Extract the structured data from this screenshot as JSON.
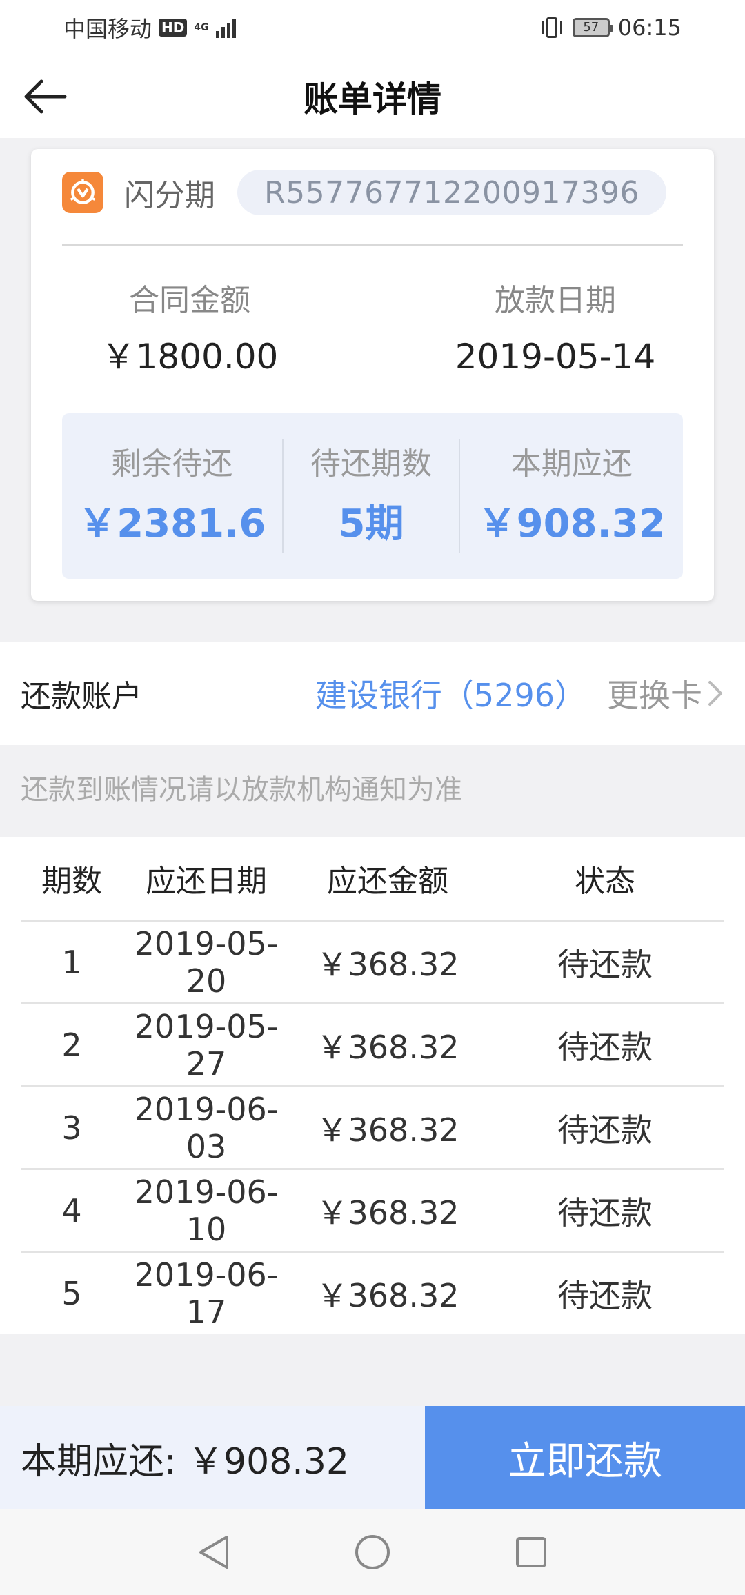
{
  "status_bar": {
    "carrier": "中国移动",
    "hd": "HD",
    "network": "4G",
    "battery": "57",
    "time": "06:15"
  },
  "header": {
    "title": "账单详情"
  },
  "loan": {
    "product_name": "闪分期",
    "contract_no": "R557767712200917396",
    "contract_amount_label": "合同金额",
    "contract_amount": "￥1800.00",
    "disburse_date_label": "放款日期",
    "disburse_date": "2019-05-14",
    "stats": [
      {
        "label": "剩余待还",
        "value": "￥2381.6"
      },
      {
        "label": "待还期数",
        "value": "5期"
      },
      {
        "label": "本期应还",
        "value": "￥908.32"
      }
    ]
  },
  "account": {
    "label": "还款账户",
    "bank": "建设银行（5296）",
    "change_label": "更换卡"
  },
  "notice": "还款到账情况请以放款机构通知为准",
  "schedule": {
    "headers": [
      "期数",
      "应还日期",
      "应还金额",
      "状态"
    ],
    "rows": [
      {
        "period": "1",
        "date": "2019-05-20",
        "amount": "￥368.32",
        "status": "待还款"
      },
      {
        "period": "2",
        "date": "2019-05-27",
        "amount": "￥368.32",
        "status": "待还款"
      },
      {
        "period": "3",
        "date": "2019-06-03",
        "amount": "￥368.32",
        "status": "待还款"
      },
      {
        "period": "4",
        "date": "2019-06-10",
        "amount": "￥368.32",
        "status": "待还款"
      },
      {
        "period": "5",
        "date": "2019-06-17",
        "amount": "￥368.32",
        "status": "待还款"
      }
    ]
  },
  "bottom_bar": {
    "due_text": "本期应还: ￥908.32",
    "pay_button": "立即还款"
  },
  "colors": {
    "accent": "#5690ec",
    "brand_orange": "#f5883a",
    "panel_bg": "#edf1fa"
  },
  "icons": {
    "back": "back-arrow-icon",
    "brand": "brand-logo-icon",
    "chevron": "chevron-right-icon",
    "nav_back": "nav-back-icon",
    "nav_home": "nav-home-icon",
    "nav_recent": "nav-recent-icon"
  }
}
